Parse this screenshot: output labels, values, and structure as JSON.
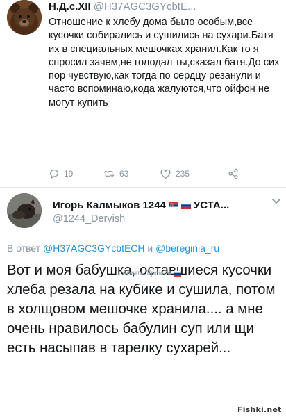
{
  "tweet1": {
    "name": "Н.Д.с.XII",
    "handle": "@H37AGC3GYcbtE...",
    "text": "Отношение к хлебу дома было особым,все кусочки собирались и сушились на сухари.Батя их в специальных мешочках хранил.Как то я спросил зачем,не голодал ты,сказал батя.До сих пор чувствую,как тогда по сердцу резанули и часто вспоминаю,кода жалуются,что ойфон не могут купить",
    "replies": "19",
    "retweets": "63",
    "likes": "235",
    "icons": {
      "reply": "reply-icon",
      "retweet": "retweet-icon",
      "like": "heart-icon",
      "share": "share-icon"
    }
  },
  "tweet2": {
    "name": "Игорь Калмыков 1244",
    "name_suffix": "УСТА...",
    "handle": "@1244_Dervish",
    "reply_prefix": "В ответ",
    "reply_to_1": "@H37AGC3GYcbtECH",
    "reply_and": "и",
    "reply_to_2": "@bereginia_ru",
    "text": "Вот и моя бабушка, оставшиеся кусочки хлеба резала на кубике и сушила, потом в холщовом мешочке хранила.... а мне очень нравилось бабулин суп или щи есть насыпав в тарелку сухарей..."
  },
  "watermark": "Агенты Кремля",
  "site_logo": "Fishki.net",
  "colors": {
    "text": "#14171a",
    "secondary": "#8a949e",
    "link": "#1b95e0",
    "divider": "#e1e8ed"
  }
}
